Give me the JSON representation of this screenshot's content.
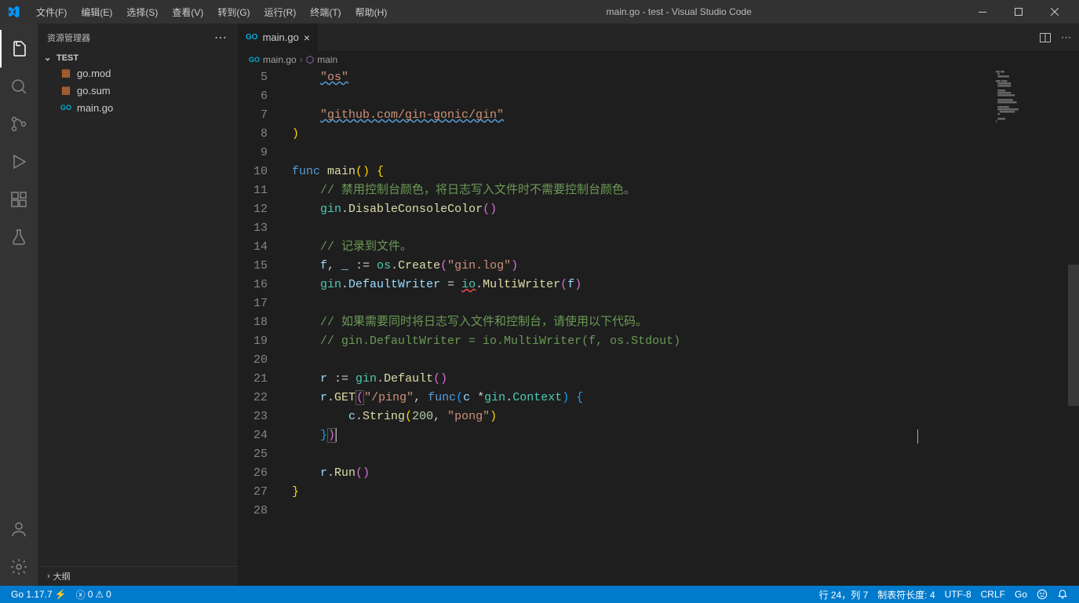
{
  "title": "main.go - test - Visual Studio Code",
  "menus": [
    "文件(F)",
    "编辑(E)",
    "选择(S)",
    "查看(V)",
    "转到(G)",
    "运行(R)",
    "终端(T)",
    "帮助(H)"
  ],
  "explorer_label": "资源管理器",
  "folder": "TEST",
  "files": [
    {
      "name": "go.mod",
      "icon": "📦",
      "color": "#e37933"
    },
    {
      "name": "go.sum",
      "icon": "📦",
      "color": "#e37933"
    },
    {
      "name": "main.go",
      "icon": "GO",
      "color": "#00add8"
    }
  ],
  "outline_label": "大纲",
  "tab": {
    "name": "main.go",
    "icon": "GO"
  },
  "breadcrumb": {
    "file": "main.go",
    "symbol": "main"
  },
  "code_start": 5,
  "status": {
    "go_ver": "Go 1.17.7",
    "errors": "0",
    "warnings": "0",
    "ln_col": "行 24，列 7",
    "tab": "制表符长度: 4",
    "encoding": "UTF-8",
    "eol": "CRLF",
    "lang": "Go"
  }
}
